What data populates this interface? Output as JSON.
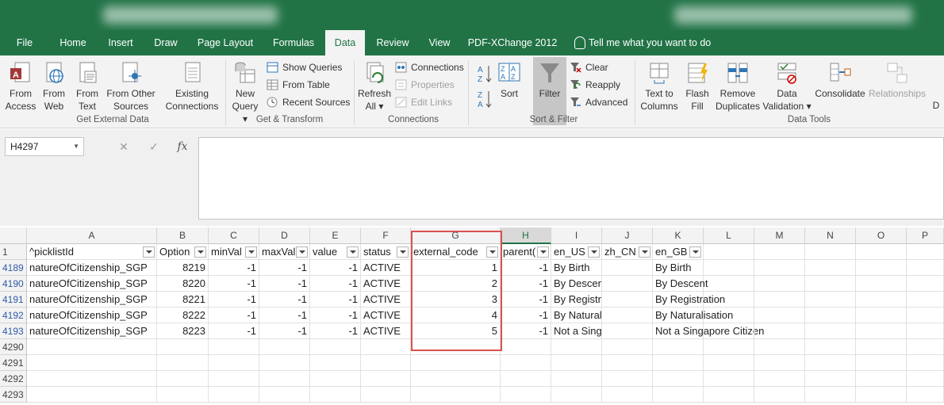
{
  "ribbon_tabs": [
    "File",
    "Home",
    "Insert",
    "Draw",
    "Page Layout",
    "Formulas",
    "Data",
    "Review",
    "View",
    "PDF-XChange 2012"
  ],
  "tell_me": "Tell me what you want to do",
  "groups": {
    "get_external": {
      "label": "Get External Data",
      "from_access": [
        "From",
        "Access"
      ],
      "from_web": [
        "From",
        "Web"
      ],
      "from_text": [
        "From",
        "Text"
      ],
      "from_other": [
        "From Other",
        "Sources"
      ],
      "existing": [
        "Existing",
        "Connections"
      ]
    },
    "get_transform": {
      "label": "Get & Transform",
      "new_query": [
        "New",
        "Query"
      ],
      "show_queries": "Show Queries",
      "from_table": "From Table",
      "recent_sources": "Recent Sources"
    },
    "connections": {
      "label": "Connections",
      "refresh": [
        "Refresh",
        "All"
      ],
      "connections": "Connections",
      "properties": "Properties",
      "edit_links": "Edit Links"
    },
    "sort_filter": {
      "label": "Sort & Filter",
      "sort": "Sort",
      "filter": "Filter",
      "clear": "Clear",
      "reapply": "Reapply",
      "advanced": "Advanced"
    },
    "data_tools": {
      "label": "Data Tools",
      "text_to_columns": [
        "Text to",
        "Columns"
      ],
      "flash_fill": [
        "Flash",
        "Fill"
      ],
      "remove_duplicates": [
        "Remove",
        "Duplicates"
      ],
      "data_validation": [
        "Data",
        "Validation"
      ],
      "consolidate": "Consolidate",
      "relationships": "Relationships",
      "cut_off": "D"
    }
  },
  "formula_bar": {
    "name_box": "H4297",
    "cancel": "✕",
    "enter": "✓",
    "fx": "fx",
    "content": ""
  },
  "columns": [
    "A",
    "B",
    "C",
    "D",
    "E",
    "F",
    "G",
    "H",
    "I",
    "J",
    "K",
    "L",
    "M",
    "N",
    "O",
    "P"
  ],
  "header_row_num": "1",
  "headers": [
    "^picklistId",
    "Option",
    "minVal",
    "maxVal",
    "value",
    "status",
    "external_code",
    "parent(",
    "en_US",
    "zh_CN",
    "en_GB"
  ],
  "rows": [
    {
      "num": "4189",
      "cells": [
        "natureOfCitizenship_SGP",
        "8219",
        "-1",
        "-1",
        "-1",
        "ACTIVE",
        "1",
        "-1",
        "By Birth",
        "",
        "By Birth"
      ]
    },
    {
      "num": "4190",
      "cells": [
        "natureOfCitizenship_SGP",
        "8220",
        "-1",
        "-1",
        "-1",
        "ACTIVE",
        "2",
        "-1",
        "By Descent",
        "",
        "By Descent"
      ]
    },
    {
      "num": "4191",
      "cells": [
        "natureOfCitizenship_SGP",
        "8221",
        "-1",
        "-1",
        "-1",
        "ACTIVE",
        "3",
        "-1",
        "By Registration",
        "",
        "By Registration"
      ]
    },
    {
      "num": "4192",
      "cells": [
        "natureOfCitizenship_SGP",
        "8222",
        "-1",
        "-1",
        "-1",
        "ACTIVE",
        "4",
        "-1",
        "By Naturalization",
        "",
        "By Naturalisation"
      ]
    },
    {
      "num": "4193",
      "cells": [
        "natureOfCitizenship_SGP",
        "8223",
        "-1",
        "-1",
        "-1",
        "ACTIVE",
        "5",
        "-1",
        "Not a Singapore Citiz",
        "",
        "Not a Singapore Citizen"
      ]
    }
  ],
  "empty_rows": [
    "4290",
    "4291",
    "4292",
    "4293"
  ],
  "colors": {
    "accent": "#217346",
    "highlight": "#d9524f",
    "row_number": "#2f5aa8"
  }
}
